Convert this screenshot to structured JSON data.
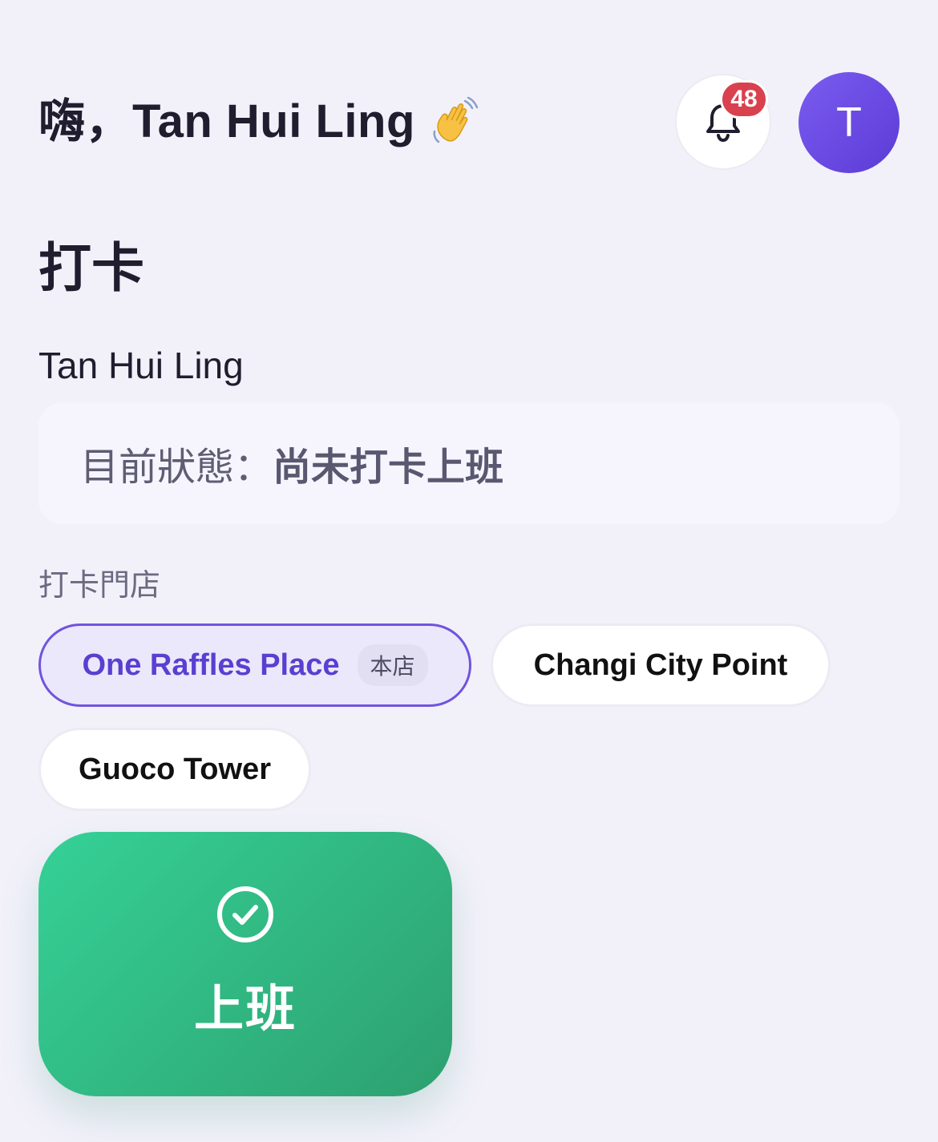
{
  "header": {
    "greeting": "嗨，Tan Hui Ling",
    "greeting_emoji": "waving-hand-icon",
    "notification_count": "48",
    "avatar_initial": "T"
  },
  "clock": {
    "title": "打卡",
    "employee_name": "Tan Hui Ling",
    "status_label": "目前狀態：",
    "status_value": "尚未打卡上班",
    "store_label": "打卡門店",
    "stores": [
      {
        "name": "One Raffles Place",
        "tag": "本店",
        "selected": true
      },
      {
        "name": "Changi City Point",
        "selected": false
      },
      {
        "name": "Guoco Tower",
        "selected": false
      }
    ],
    "action_label": "上班",
    "action_icon": "check-circle-icon"
  },
  "colors": {
    "background": "#f2f1fa",
    "accent": "#7054dd",
    "badge": "#d9414f",
    "action": "#2fb27f"
  }
}
